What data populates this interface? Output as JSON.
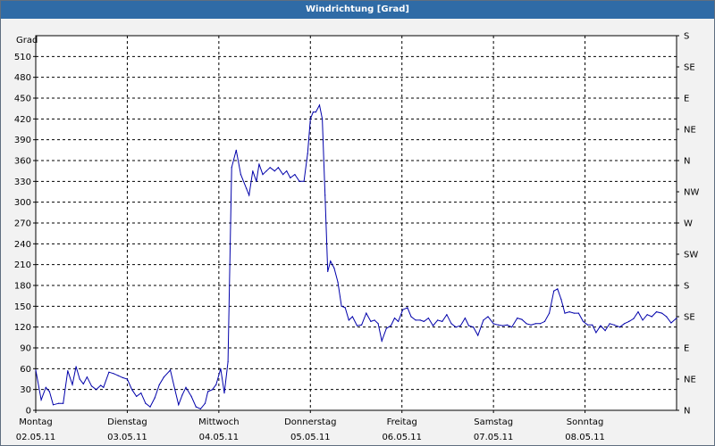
{
  "window": {
    "title": "Windrichtung [Grad]"
  },
  "chart_data": {
    "type": "line",
    "title": "Windrichtung [Grad]",
    "ylabel": "Grad",
    "ylim": [
      0,
      540
    ],
    "yticks": [
      0,
      30,
      60,
      90,
      120,
      150,
      180,
      210,
      240,
      270,
      300,
      330,
      360,
      390,
      420,
      450,
      480,
      510
    ],
    "y2ticks": [
      {
        "value": 0,
        "label": "N"
      },
      {
        "value": 45,
        "label": "NE"
      },
      {
        "value": 90,
        "label": "E"
      },
      {
        "value": 135,
        "label": "SE"
      },
      {
        "value": 180,
        "label": "S"
      },
      {
        "value": 225,
        "label": "SW"
      },
      {
        "value": 270,
        "label": "W"
      },
      {
        "value": 315,
        "label": "NW"
      },
      {
        "value": 360,
        "label": "N"
      },
      {
        "value": 405,
        "label": "NE"
      },
      {
        "value": 450,
        "label": "E"
      },
      {
        "value": 495,
        "label": "SE"
      },
      {
        "value": 540,
        "label": "S"
      }
    ],
    "days": [
      {
        "weekday": "Montag",
        "date": "02.05.11"
      },
      {
        "weekday": "Dienstag",
        "date": "03.05.11"
      },
      {
        "weekday": "Mittwoch",
        "date": "04.05.11"
      },
      {
        "weekday": "Donnerstag",
        "date": "05.05.11"
      },
      {
        "weekday": "Freitag",
        "date": "06.05.11"
      },
      {
        "weekday": "Samstag",
        "date": "07.05.11"
      },
      {
        "weekday": "Sonntag",
        "date": "08.05.11"
      }
    ],
    "xlim_days": [
      0,
      7
    ],
    "grid": true,
    "line_color": "#0000aa",
    "series": [
      {
        "values": [
          [
            0.0,
            58
          ],
          [
            0.06,
            15
          ],
          [
            0.11,
            33
          ],
          [
            0.15,
            27
          ],
          [
            0.19,
            8
          ],
          [
            0.25,
            10
          ],
          [
            0.3,
            10
          ],
          [
            0.35,
            57
          ],
          [
            0.4,
            37
          ],
          [
            0.44,
            63
          ],
          [
            0.48,
            45
          ],
          [
            0.52,
            38
          ],
          [
            0.56,
            48
          ],
          [
            0.61,
            35
          ],
          [
            0.66,
            30
          ],
          [
            0.71,
            36
          ],
          [
            0.74,
            33
          ],
          [
            0.8,
            55
          ],
          [
            0.85,
            53
          ],
          [
            0.9,
            50
          ],
          [
            0.95,
            47
          ],
          [
            1.0,
            45
          ],
          [
            1.05,
            30
          ],
          [
            1.1,
            20
          ],
          [
            1.15,
            25
          ],
          [
            1.2,
            10
          ],
          [
            1.25,
            5
          ],
          [
            1.3,
            18
          ],
          [
            1.35,
            37
          ],
          [
            1.4,
            48
          ],
          [
            1.47,
            58
          ],
          [
            1.52,
            30
          ],
          [
            1.56,
            8
          ],
          [
            1.6,
            22
          ],
          [
            1.64,
            33
          ],
          [
            1.7,
            20
          ],
          [
            1.75,
            5
          ],
          [
            1.8,
            2
          ],
          [
            1.85,
            10
          ],
          [
            1.88,
            27
          ],
          [
            1.93,
            30
          ],
          [
            1.97,
            37
          ],
          [
            2.02,
            60
          ],
          [
            2.06,
            25
          ],
          [
            2.1,
            70
          ],
          [
            2.14,
            350
          ],
          [
            2.19,
            375
          ],
          [
            2.24,
            340
          ],
          [
            2.3,
            320
          ],
          [
            2.33,
            310
          ],
          [
            2.37,
            345
          ],
          [
            2.41,
            330
          ],
          [
            2.44,
            355
          ],
          [
            2.48,
            340
          ],
          [
            2.52,
            345
          ],
          [
            2.56,
            350
          ],
          [
            2.61,
            345
          ],
          [
            2.65,
            350
          ],
          [
            2.7,
            340
          ],
          [
            2.74,
            345
          ],
          [
            2.78,
            335
          ],
          [
            2.83,
            340
          ],
          [
            2.88,
            330
          ],
          [
            2.93,
            330
          ],
          [
            2.97,
            370
          ],
          [
            3.0,
            420
          ],
          [
            3.03,
            430
          ],
          [
            3.06,
            430
          ],
          [
            3.1,
            440
          ],
          [
            3.13,
            420
          ],
          [
            3.16,
            310
          ],
          [
            3.19,
            200
          ],
          [
            3.22,
            215
          ],
          [
            3.26,
            205
          ],
          [
            3.3,
            185
          ],
          [
            3.34,
            150
          ],
          [
            3.38,
            148
          ],
          [
            3.42,
            130
          ],
          [
            3.46,
            135
          ],
          [
            3.51,
            122
          ],
          [
            3.56,
            123
          ],
          [
            3.61,
            140
          ],
          [
            3.66,
            128
          ],
          [
            3.7,
            130
          ],
          [
            3.74,
            125
          ],
          [
            3.78,
            100
          ],
          [
            3.83,
            118
          ],
          [
            3.88,
            122
          ],
          [
            3.92,
            133
          ],
          [
            3.96,
            128
          ],
          [
            4.01,
            145
          ],
          [
            4.06,
            148
          ],
          [
            4.1,
            135
          ],
          [
            4.15,
            130
          ],
          [
            4.2,
            130
          ],
          [
            4.24,
            128
          ],
          [
            4.29,
            133
          ],
          [
            4.34,
            122
          ],
          [
            4.39,
            130
          ],
          [
            4.44,
            128
          ],
          [
            4.49,
            138
          ],
          [
            4.54,
            125
          ],
          [
            4.59,
            120
          ],
          [
            4.64,
            122
          ],
          [
            4.69,
            133
          ],
          [
            4.73,
            122
          ],
          [
            4.78,
            120
          ],
          [
            4.83,
            108
          ],
          [
            4.89,
            130
          ],
          [
            4.94,
            135
          ],
          [
            5.0,
            125
          ],
          [
            5.05,
            123
          ],
          [
            5.1,
            122
          ],
          [
            5.15,
            123
          ],
          [
            5.2,
            120
          ],
          [
            5.26,
            133
          ],
          [
            5.31,
            131
          ],
          [
            5.36,
            125
          ],
          [
            5.41,
            123
          ],
          [
            5.46,
            125
          ],
          [
            5.51,
            125
          ],
          [
            5.56,
            128
          ],
          [
            5.61,
            140
          ],
          [
            5.66,
            172
          ],
          [
            5.7,
            175
          ],
          [
            5.74,
            160
          ],
          [
            5.78,
            140
          ],
          [
            5.83,
            142
          ],
          [
            5.88,
            140
          ],
          [
            5.93,
            140
          ],
          [
            5.98,
            128
          ],
          [
            6.03,
            123
          ],
          [
            6.08,
            123
          ],
          [
            6.12,
            112
          ],
          [
            6.17,
            122
          ],
          [
            6.22,
            115
          ],
          [
            6.27,
            125
          ],
          [
            6.32,
            123
          ],
          [
            6.38,
            120
          ],
          [
            6.43,
            125
          ],
          [
            6.48,
            128
          ],
          [
            6.53,
            132
          ],
          [
            6.58,
            142
          ],
          [
            6.63,
            130
          ],
          [
            6.68,
            138
          ],
          [
            6.73,
            135
          ],
          [
            6.78,
            142
          ],
          [
            6.84,
            140
          ],
          [
            6.89,
            135
          ],
          [
            6.94,
            126
          ],
          [
            7.0,
            133
          ]
        ]
      }
    ]
  }
}
